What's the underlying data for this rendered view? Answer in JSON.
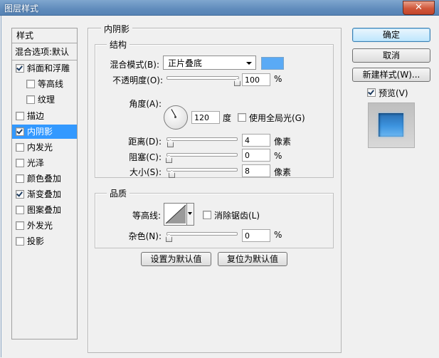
{
  "window": {
    "title": "图层样式",
    "close_glyph": "✕"
  },
  "style_list": {
    "header": "样式",
    "blend_options": "混合选项:默认",
    "items": [
      {
        "label": "斜面和浮雕",
        "checked": true
      },
      {
        "label": "等高线",
        "checked": false
      },
      {
        "label": "纹理",
        "checked": false
      },
      {
        "label": "描边",
        "checked": false
      },
      {
        "label": "内阴影",
        "checked": true
      },
      {
        "label": "内发光",
        "checked": false
      },
      {
        "label": "光泽",
        "checked": false
      },
      {
        "label": "颜色叠加",
        "checked": false
      },
      {
        "label": "渐变叠加",
        "checked": true
      },
      {
        "label": "图案叠加",
        "checked": false
      },
      {
        "label": "外发光",
        "checked": false
      },
      {
        "label": "投影",
        "checked": false
      }
    ]
  },
  "panel": {
    "title": "内阴影",
    "structure": {
      "title": "结构",
      "blend_mode_label": "混合模式(B):",
      "blend_mode_value": "正片叠底",
      "opacity_label": "不透明度(O):",
      "opacity_value": "100",
      "percent": "%",
      "angle_label": "角度(A):",
      "angle_value": "120",
      "degree": "度",
      "global_light_label": "使用全局光(G)",
      "distance_label": "距离(D):",
      "distance_value": "4",
      "pixels": "像素",
      "choke_label": "阻塞(C):",
      "choke_value": "0",
      "size_label": "大小(S):",
      "size_value": "8"
    },
    "quality": {
      "title": "品质",
      "contour_label": "等高线:",
      "antialias_label": "消除锯齿(L)",
      "noise_label": "杂色(N):",
      "noise_value": "0",
      "percent": "%"
    },
    "set_default": "设置为默认值",
    "reset_default": "复位为默认值"
  },
  "actions": {
    "ok": "确定",
    "cancel": "取消",
    "new_style": "新建样式(W)...",
    "preview_label": "预览(V)",
    "preview_checked": true
  },
  "colors": {
    "shadow_color": "#5aaaf5",
    "selection": "#3399ff"
  }
}
